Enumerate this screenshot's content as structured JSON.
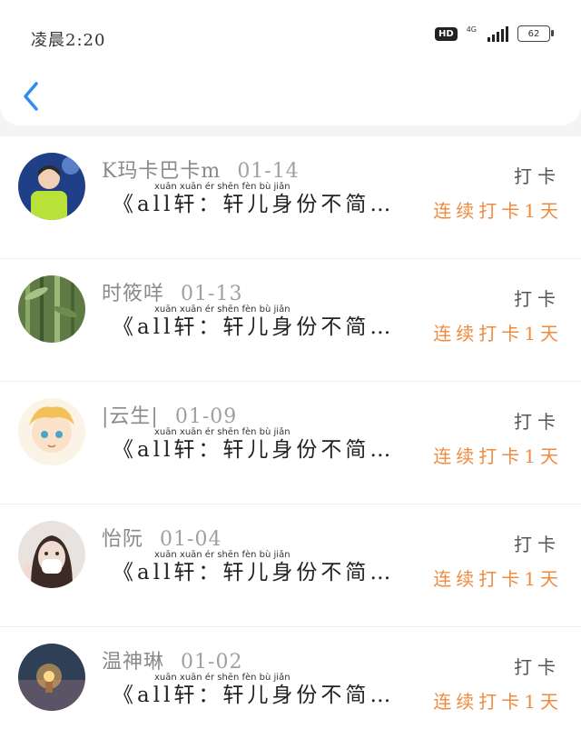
{
  "status_bar": {
    "time": "凌晨2:20",
    "hd": "HD",
    "network": "4G",
    "battery": "62"
  },
  "header": {
    "back_icon": "chevron-left-icon"
  },
  "colors": {
    "accent": "#2f8cf5",
    "streak": "#f08a3e"
  },
  "items": [
    {
      "name": "K玛卡巴卡m",
      "date": "01-14",
      "title": "《all轩：轩儿身份不简…",
      "title_pinyin": "xuān    xuān  ér  shēn  fèn  bù  jiǎn",
      "checkin": "打卡",
      "streak": "连续打卡1天",
      "avatar": "avatar-boy-green"
    },
    {
      "name": "时筱咩",
      "date": "01-13",
      "title": "《all轩：轩儿身份不简…",
      "title_pinyin": "xuān    xuān  ér  shēn  fèn  bù  jiǎn",
      "checkin": "打卡",
      "streak": "连续打卡1天",
      "avatar": "avatar-bamboo"
    },
    {
      "name": "|云生|",
      "date": "01-09",
      "title": "《all轩：轩儿身份不简…",
      "title_pinyin": "xuān    xuān  ér  shēn  fèn  bù  jiǎn",
      "checkin": "打卡",
      "streak": "连续打卡1天",
      "avatar": "avatar-anime"
    },
    {
      "name": "怡阮",
      "date": "01-04",
      "title": "《all轩：轩儿身份不简…",
      "title_pinyin": "xuān    xuān  ér  shēn  fèn  bù  jiǎn",
      "checkin": "打卡",
      "streak": "连续打卡1天",
      "avatar": "avatar-girl-mask"
    },
    {
      "name": "温神琳",
      "date": "01-02",
      "title": "《all轩：轩儿身份不简…",
      "title_pinyin": "xuān    xuān  ér  shēn  fèn  bù  jiǎn",
      "checkin": "打卡",
      "streak": "连续打卡1天",
      "avatar": "avatar-lamp"
    }
  ]
}
